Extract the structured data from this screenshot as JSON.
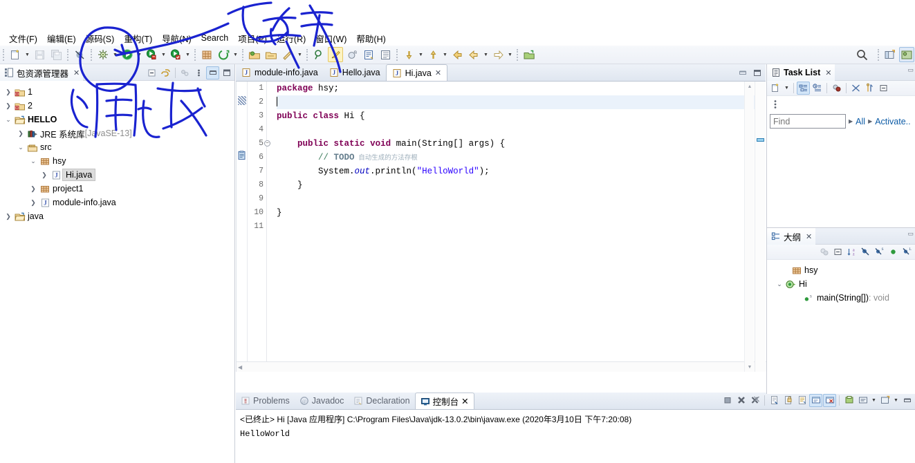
{
  "app": {
    "title": "Eclipse IDE",
    "accent": "#0c5ba6",
    "ink_color": "#1a23d0"
  },
  "menubar": {
    "items": [
      {
        "label": "文件(F)",
        "name": "menu-file"
      },
      {
        "label": "编辑(E)",
        "name": "menu-edit"
      },
      {
        "label": "源码(S)",
        "name": "menu-source"
      },
      {
        "label": "重构(T)",
        "name": "menu-refactor"
      },
      {
        "label": "导航(N)",
        "name": "menu-navigate"
      },
      {
        "label": "Search",
        "name": "menu-search"
      },
      {
        "label": "项目(P)",
        "name": "menu-project"
      },
      {
        "label": "运行(R)",
        "name": "menu-run"
      },
      {
        "label": "窗口(W)",
        "name": "menu-window"
      },
      {
        "label": "帮助(H)",
        "name": "menu-help"
      }
    ]
  },
  "toolbar": {
    "buttons": [
      {
        "name": "new-wizard-icon",
        "label": "新建"
      },
      {
        "name": "save-icon",
        "label": "保存"
      },
      {
        "name": "save-all-icon",
        "label": "全部保存"
      },
      {
        "name": "toggle-breakpoint-icon",
        "label": "跳过所有断点"
      },
      {
        "name": "debug-icon",
        "label": "调试"
      },
      {
        "name": "run-icon",
        "label": "运行"
      },
      {
        "name": "run-external-tool-icon",
        "label": "外部工具"
      },
      {
        "name": "coverage-icon",
        "label": "覆盖"
      },
      {
        "name": "new-java-project-icon",
        "label": "新建 Java 项目"
      },
      {
        "name": "new-package-icon",
        "label": "新建包"
      },
      {
        "name": "open-type-icon",
        "label": "打开类型"
      },
      {
        "name": "open-task-icon",
        "label": "打开任务"
      },
      {
        "name": "search-scope-icon",
        "label": "搜索"
      },
      {
        "name": "pin-editor-icon",
        "label": "固定编辑器"
      },
      {
        "name": "mark-occurrences-icon",
        "label": "切换标记出现次数"
      },
      {
        "name": "build-all-icon",
        "label": "全部构建"
      },
      {
        "name": "show-whitespace-icon",
        "label": "显示空格字符"
      },
      {
        "name": "pilcrow-icon",
        "label": "段落标记"
      },
      {
        "name": "next-annotation-icon",
        "label": "下一个注释"
      },
      {
        "name": "prev-annotation-icon",
        "label": "上一个注释"
      },
      {
        "name": "back-icon",
        "label": "后退"
      },
      {
        "name": "forward-icon",
        "label": "前进"
      },
      {
        "name": "last-edit-icon",
        "label": "上次编辑位置"
      },
      {
        "name": "open-perspective-icon",
        "label": "打开透视图"
      },
      {
        "name": "magnifier-icon",
        "label": "快速访问"
      }
    ]
  },
  "package_explorer": {
    "tab_title": "包资源管理器",
    "close_label": "✕",
    "actions": [
      {
        "name": "collapse-all-icon",
        "label": "全部折叠"
      },
      {
        "name": "link-with-editor-icon",
        "label": "与编辑器关联"
      },
      {
        "name": "view-menu-icon",
        "label": "视图菜单"
      },
      {
        "name": "view-kebab-icon",
        "label": "更多"
      },
      {
        "name": "minimize-icon",
        "label": "最小化"
      },
      {
        "name": "maximize-icon",
        "label": "最大化"
      }
    ],
    "tree": [
      {
        "label": "1",
        "indent": 0,
        "icon": "project-closed-error-icon",
        "twisty": "collapsed",
        "selected": false,
        "suffix": ""
      },
      {
        "label": "2",
        "indent": 0,
        "icon": "project-closed-error-icon",
        "twisty": "collapsed",
        "selected": false,
        "suffix": ""
      },
      {
        "label": "HELLO",
        "indent": 0,
        "icon": "project-open-icon",
        "twisty": "expanded",
        "selected": false,
        "suffix": ""
      },
      {
        "label": "JRE 系统库",
        "indent": 1,
        "icon": "library-icon",
        "twisty": "collapsed",
        "selected": false,
        "suffix": " [JavaSE-13]"
      },
      {
        "label": "src",
        "indent": 1,
        "icon": "source-folder-icon",
        "twisty": "expanded",
        "selected": false,
        "suffix": ""
      },
      {
        "label": "hsy",
        "indent": 2,
        "icon": "package-icon",
        "twisty": "expanded",
        "selected": false,
        "suffix": ""
      },
      {
        "label": "Hi.java",
        "indent": 3,
        "icon": "java-file-icon",
        "twisty": "collapsed",
        "selected": true,
        "suffix": ""
      },
      {
        "label": "project1",
        "indent": 2,
        "icon": "package-icon",
        "twisty": "collapsed",
        "selected": false,
        "suffix": ""
      },
      {
        "label": "module-info.java",
        "indent": 2,
        "icon": "java-file-icon",
        "twisty": "collapsed",
        "selected": false,
        "suffix": ""
      },
      {
        "label": "java",
        "indent": 0,
        "icon": "project-open-icon",
        "twisty": "collapsed",
        "selected": false,
        "suffix": ""
      }
    ]
  },
  "editor": {
    "tabs": [
      {
        "label": "module-info.java",
        "active": false,
        "closeable": false,
        "name": "editor-tab-module-info"
      },
      {
        "label": "Hello.java",
        "active": false,
        "closeable": false,
        "name": "editor-tab-hello"
      },
      {
        "label": "Hi.java",
        "active": true,
        "closeable": true,
        "name": "editor-tab-hi"
      }
    ],
    "close_label": "✕",
    "actions": [
      {
        "name": "editor-minimize-icon",
        "label": "最小化"
      },
      {
        "name": "editor-maximize-icon",
        "label": "最大化"
      }
    ],
    "line_numbers": [
      "1",
      "2",
      "3",
      "4",
      "5",
      "6",
      "7",
      "8",
      "9",
      "10",
      "11"
    ],
    "fold_lines": [
      "5"
    ],
    "current_line": 2,
    "code_lines": [
      {
        "n": 1,
        "segments": [
          {
            "t": "package",
            "c": "kw"
          },
          {
            "t": " hsy;",
            "c": ""
          }
        ]
      },
      {
        "n": 2,
        "segments": [
          {
            "t": "",
            "c": "caret"
          }
        ]
      },
      {
        "n": 3,
        "segments": [
          {
            "t": "public",
            "c": "kw"
          },
          {
            "t": " ",
            "c": ""
          },
          {
            "t": "class",
            "c": "kw"
          },
          {
            "t": " Hi {",
            "c": ""
          }
        ]
      },
      {
        "n": 4,
        "segments": [
          {
            "t": "",
            "c": ""
          }
        ]
      },
      {
        "n": 5,
        "segments": [
          {
            "t": "    ",
            "c": ""
          },
          {
            "t": "public",
            "c": "kw"
          },
          {
            "t": " ",
            "c": ""
          },
          {
            "t": "static",
            "c": "kw"
          },
          {
            "t": " ",
            "c": ""
          },
          {
            "t": "void",
            "c": "kw"
          },
          {
            "t": " main(String[] args) {",
            "c": ""
          }
        ]
      },
      {
        "n": 6,
        "segments": [
          {
            "t": "        ",
            "c": ""
          },
          {
            "t": "// ",
            "c": "cmt"
          },
          {
            "t": "TODO",
            "c": "todo"
          },
          {
            "t": " 自动生成的方法存根",
            "c": "todo-cn"
          }
        ]
      },
      {
        "n": 7,
        "segments": [
          {
            "t": "        System.",
            "c": ""
          },
          {
            "t": "out",
            "c": "fld"
          },
          {
            "t": ".println(",
            "c": ""
          },
          {
            "t": "\"HelloWorld\"",
            "c": "str"
          },
          {
            "t": ");",
            "c": ""
          }
        ]
      },
      {
        "n": 8,
        "segments": [
          {
            "t": "    }",
            "c": ""
          }
        ]
      },
      {
        "n": 9,
        "segments": [
          {
            "t": "",
            "c": ""
          }
        ]
      },
      {
        "n": 10,
        "segments": [
          {
            "t": "}",
            "c": ""
          }
        ]
      },
      {
        "n": 11,
        "segments": [
          {
            "t": "",
            "c": ""
          }
        ]
      }
    ]
  },
  "console": {
    "tabs": [
      {
        "label": "Problems",
        "icon": "problems-icon",
        "active": false,
        "name": "bottom-tab-problems"
      },
      {
        "label": "Javadoc",
        "icon": "javadoc-icon",
        "active": false,
        "name": "bottom-tab-javadoc"
      },
      {
        "label": "Declaration",
        "icon": "declaration-icon",
        "active": false,
        "name": "bottom-tab-declaration"
      },
      {
        "label": "控制台",
        "icon": "console-icon",
        "active": true,
        "name": "bottom-tab-console"
      }
    ],
    "close_label": "✕",
    "header": "<已终止> Hi [Java 应用程序] C:\\Program Files\\Java\\jdk-13.0.2\\bin\\javaw.exe (2020年3月10日 下午7:20:08)",
    "output": "HelloWorld",
    "actions": [
      {
        "name": "terminate-icon",
        "label": "终止",
        "selected": false
      },
      {
        "name": "remove-launch-icon",
        "label": "移除已启动项",
        "selected": false
      },
      {
        "name": "remove-all-launches-icon",
        "label": "移除所有已终止的启动",
        "selected": false
      },
      {
        "name": "clear-console-icon",
        "label": "清除控制台",
        "selected": false
      },
      {
        "name": "scroll-lock-icon",
        "label": "滚动锁定",
        "selected": false
      },
      {
        "name": "word-wrap-icon",
        "label": "自动换行",
        "selected": false
      },
      {
        "name": "show-console-on-output-icon",
        "label": "标准输出时显示控制台",
        "selected": true
      },
      {
        "name": "show-console-on-error-icon",
        "label": "标准错误时显示控制台",
        "selected": true
      },
      {
        "name": "pin-console-icon",
        "label": "固定控制台",
        "selected": false
      },
      {
        "name": "display-selected-console-icon",
        "label": "显示选定的控制台",
        "selected": false
      },
      {
        "name": "open-console-icon",
        "label": "打开控制台",
        "selected": false
      },
      {
        "name": "console-minimize-icon",
        "label": "最小化",
        "selected": false
      }
    ]
  },
  "task_list": {
    "tab_title": "Task List",
    "close_label": "✕",
    "toolbar": [
      {
        "name": "new-task-icon",
        "label": "新建任务",
        "selected": false
      },
      {
        "name": "categorized-presentation-icon",
        "label": "分类显示",
        "selected": true
      },
      {
        "name": "scheduled-presentation-icon",
        "label": "计划显示",
        "selected": false
      },
      {
        "name": "focus-on-workweek-icon",
        "label": "聚焦本周",
        "selected": false
      },
      {
        "name": "synchronize-changed-icon",
        "label": "同步已更改",
        "selected": false
      },
      {
        "name": "collapse-all-tasks-icon",
        "label": "全部折叠",
        "selected": false
      },
      {
        "name": "task-list-menu-icon",
        "label": "视图菜单",
        "selected": false
      },
      {
        "name": "task-list-kebab-icon",
        "label": "更多",
        "selected": false
      }
    ],
    "find_placeholder": "Find",
    "find_value": "",
    "filter_all": "All",
    "filter_activate": "Activate..",
    "minimize_label": "▭"
  },
  "outline": {
    "tab_title": "大纲",
    "close_label": "✕",
    "toolbar": [
      {
        "name": "focus-on-active-task-icon",
        "label": "聚焦活动任务",
        "selected": false
      },
      {
        "name": "collapse-all-outline-icon",
        "label": "全部折叠",
        "selected": false
      },
      {
        "name": "sort-alphabetically-icon",
        "label": "按字母排序",
        "selected": false
      },
      {
        "name": "hide-fields-icon",
        "label": "隐藏字段",
        "selected": false
      },
      {
        "name": "hide-static-icon",
        "label": "隐藏静态成员",
        "selected": false
      },
      {
        "name": "hide-non-public-icon",
        "label": "隐藏非公共成员",
        "selected": false
      },
      {
        "name": "hide-local-types-icon",
        "label": "隐藏局部类型",
        "selected": false
      }
    ],
    "minimize_label": "▭",
    "tree": [
      {
        "label": "hsy",
        "indent": 0,
        "icon": "package-icon",
        "twisty": "none",
        "suffix": ""
      },
      {
        "label": "Hi",
        "indent": 0,
        "icon": "class-public-icon",
        "twisty": "expanded",
        "suffix": ""
      },
      {
        "label": "main(String[])",
        "indent": 1,
        "icon": "method-public-static-icon",
        "twisty": "none",
        "suffix": " : void"
      }
    ]
  },
  "annotations": [
    {
      "name": "ink-label-run",
      "text": "运行",
      "note": "handwritten blue label pointing at run/debug toolbar buttons"
    },
    {
      "name": "ink-label-debug",
      "text": "调试",
      "note": "handwritten blue label below, with oval circling the debug bug icon"
    }
  ]
}
